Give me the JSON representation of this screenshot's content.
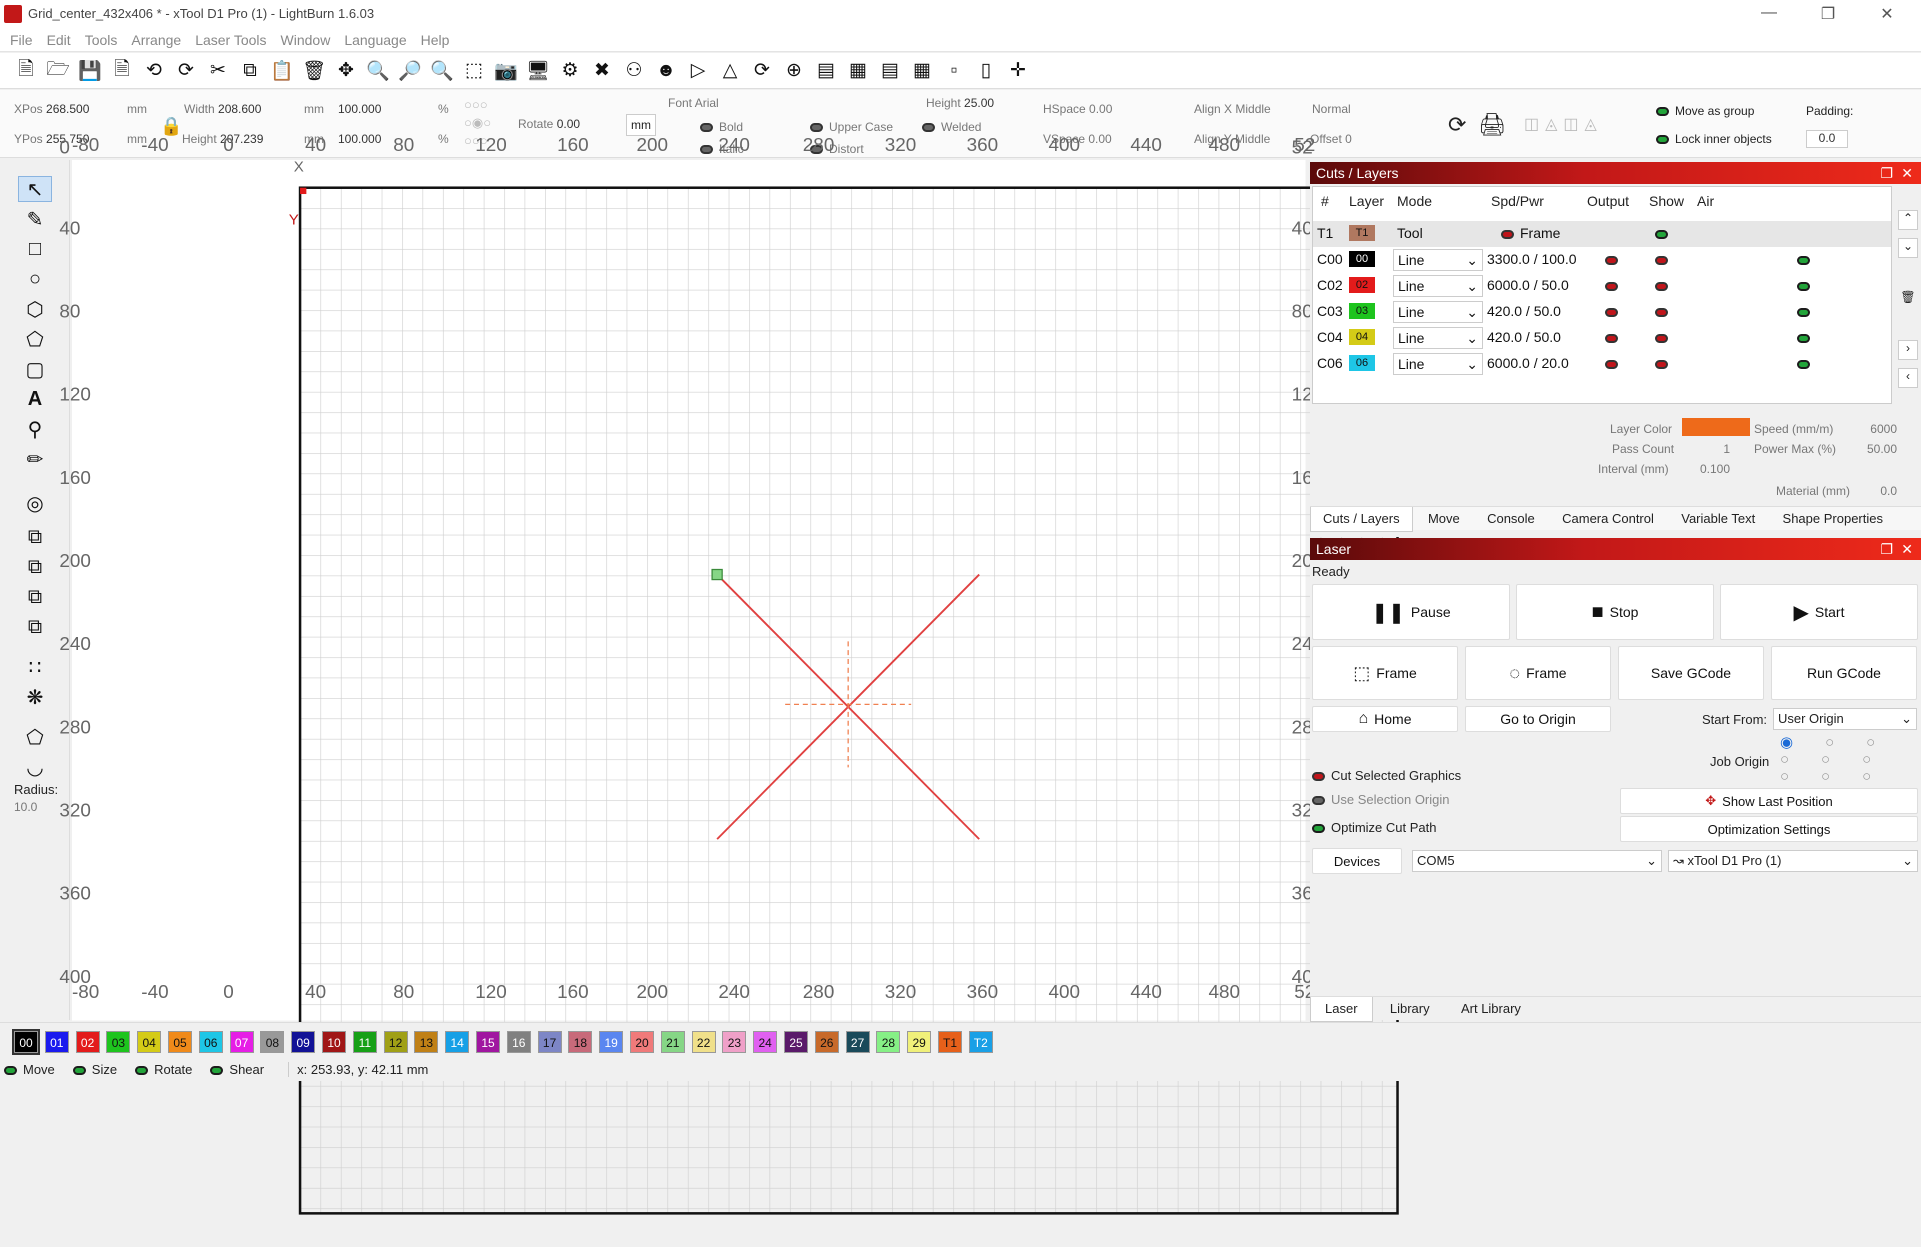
{
  "window": {
    "title": "Grid_center_432x406 * - xTool D1 Pro (1) - LightBurn 1.6.03"
  },
  "menu": [
    "File",
    "Edit",
    "Tools",
    "Arrange",
    "Laser Tools",
    "Window",
    "Language",
    "Help"
  ],
  "props": {
    "xpos_label": "XPos",
    "xpos": "268.500",
    "ypos_label": "YPos",
    "ypos": "255.750",
    "mm1": "mm",
    "mm2": "mm",
    "width_label": "Width",
    "width": "208.600",
    "height_label": "Height",
    "height": "207.239",
    "wmm": "mm",
    "hmm": "mm",
    "wpct": "100.000",
    "hpct": "100.000",
    "pct1": "%",
    "pct2": "%",
    "rotate_label": "Rotate",
    "rotate": "0.00",
    "unit_btn": "mm",
    "font_label": "Font",
    "font": "Arial",
    "fheight_label": "Height",
    "fheight": "25.00",
    "hspace_label": "HSpace",
    "hspace": "0.00",
    "vspace_label": "VSpace",
    "vspace": "0.00",
    "alignx_label": "Align X",
    "alignx": "Middle",
    "aligny_label": "Align Y",
    "aligny": "Middle",
    "normal": "Normal",
    "offset_label": "Offset",
    "offset": "0",
    "bold": "Bold",
    "italic": "Italic",
    "upper": "Upper Case",
    "distort": "Distort",
    "welded": "Welded",
    "move_group": "Move as group",
    "lock_inner": "Lock inner objects",
    "padding_label": "Padding:",
    "padding": "0.0"
  },
  "lefttools": {
    "radius_label": "Radius:",
    "radius": "10.0"
  },
  "ruler": {
    "top": [
      "-80",
      "-40",
      "0",
      "40",
      "80",
      "120",
      "160",
      "200",
      "240",
      "280",
      "320",
      "360",
      "400",
      "440",
      "480",
      "52"
    ],
    "bottom": [
      "-80",
      "-40",
      "0",
      "40",
      "80",
      "120",
      "160",
      "200",
      "240",
      "280",
      "320",
      "360",
      "400",
      "440",
      "480",
      "52"
    ],
    "left": [
      "0",
      "40",
      "80",
      "120",
      "160",
      "200",
      "240",
      "280",
      "320",
      "360",
      "400"
    ],
    "right": [
      "52",
      "40",
      "80",
      "120",
      "160",
      "200",
      "240",
      "280",
      "320",
      "360",
      "400"
    ],
    "x_marker": "X",
    "y_marker": "Y"
  },
  "cuts": {
    "title": "Cuts / Layers",
    "headers": [
      "#",
      "Layer",
      "Mode",
      "Spd/Pwr",
      "Output",
      "Show",
      "Air"
    ],
    "rows": [
      {
        "id": "T1",
        "layer": "T1",
        "color": "#b07860",
        "mode": "Tool",
        "spd": "Frame",
        "tool": true
      },
      {
        "id": "C00",
        "layer": "00",
        "color": "#000000",
        "mode": "Line",
        "spd": "3300.0 / 100.0"
      },
      {
        "id": "C02",
        "layer": "02",
        "color": "#e31b1b",
        "mode": "Line",
        "spd": "6000.0 / 50.0"
      },
      {
        "id": "C03",
        "layer": "03",
        "color": "#1ec41e",
        "mode": "Line",
        "spd": "420.0 / 50.0"
      },
      {
        "id": "C04",
        "layer": "04",
        "color": "#d4cb17",
        "mode": "Line",
        "spd": "420.0 / 50.0"
      },
      {
        "id": "C06",
        "layer": "06",
        "color": "#1ec6e6",
        "mode": "Line",
        "spd": "6000.0 / 20.0"
      }
    ],
    "layer_color_label": "Layer Color",
    "layer_color": "#ee6a1a",
    "speed_label": "Speed (mm/m)",
    "speed": "6000",
    "pass_label": "Pass Count",
    "pass": "1",
    "powermax_label": "Power Max (%)",
    "powermax": "50.00",
    "interval_label": "Interval (mm)",
    "interval": "0.100",
    "material_label": "Material (mm)",
    "material": "0.0",
    "tabs": [
      "Cuts / Layers",
      "Move",
      "Console",
      "Camera Control",
      "Variable Text",
      "Shape Properties"
    ]
  },
  "laser": {
    "title": "Laser",
    "status": "Ready",
    "pause": "Pause",
    "stop": "Stop",
    "start": "Start",
    "frame1": "Frame",
    "frame2": "Frame",
    "save_gcode": "Save GCode",
    "run_gcode": "Run GCode",
    "home": "Home",
    "go_origin": "Go to Origin",
    "start_from_label": "Start From:",
    "start_from": "User Origin",
    "job_origin_label": "Job Origin",
    "cut_selected": "Cut Selected Graphics",
    "use_sel_origin": "Use Selection Origin",
    "optimize": "Optimize Cut Path",
    "show_last": "Show Last Position",
    "opt_settings": "Optimization Settings",
    "devices": "Devices",
    "port": "COM5",
    "device": "xTool D1 Pro (1)",
    "tabs": [
      "Laser",
      "Library",
      "Art Library"
    ]
  },
  "palette": [
    {
      "l": "00",
      "c": "#000000",
      "t": "#fff"
    },
    {
      "l": "01",
      "c": "#1a1aee",
      "t": "#fff"
    },
    {
      "l": "02",
      "c": "#e31b1b",
      "t": "#fff"
    },
    {
      "l": "03",
      "c": "#1ec41e",
      "t": "#111"
    },
    {
      "l": "04",
      "c": "#d4cb17",
      "t": "#111"
    },
    {
      "l": "05",
      "c": "#f08a1a",
      "t": "#111"
    },
    {
      "l": "06",
      "c": "#1ec6e6",
      "t": "#111"
    },
    {
      "l": "07",
      "c": "#e61ee6",
      "t": "#fff"
    },
    {
      "l": "08",
      "c": "#999999",
      "t": "#111"
    },
    {
      "l": "09",
      "c": "#121296",
      "t": "#fff"
    },
    {
      "l": "10",
      "c": "#a01616",
      "t": "#fff"
    },
    {
      "l": "11",
      "c": "#16a016",
      "t": "#fff"
    },
    {
      "l": "12",
      "c": "#a0a016",
      "t": "#111"
    },
    {
      "l": "13",
      "c": "#c08016",
      "t": "#111"
    },
    {
      "l": "14",
      "c": "#16a0e6",
      "t": "#fff"
    },
    {
      "l": "15",
      "c": "#a016a0",
      "t": "#fff"
    },
    {
      "l": "16",
      "c": "#808080",
      "t": "#fff"
    },
    {
      "l": "17",
      "c": "#7d86c6",
      "t": "#111"
    },
    {
      "l": "18",
      "c": "#c86a7a",
      "t": "#111"
    },
    {
      "l": "19",
      "c": "#5a86f0",
      "t": "#fff"
    },
    {
      "l": "20",
      "c": "#f07a7a",
      "t": "#111"
    },
    {
      "l": "21",
      "c": "#86d686",
      "t": "#111"
    },
    {
      "l": "22",
      "c": "#f0e08a",
      "t": "#111"
    },
    {
      "l": "23",
      "c": "#f0a0c8",
      "t": "#111"
    },
    {
      "l": "24",
      "c": "#e060f0",
      "t": "#111"
    },
    {
      "l": "25",
      "c": "#5a1a6a",
      "t": "#fff"
    },
    {
      "l": "26",
      "c": "#c86a2a",
      "t": "#111"
    },
    {
      "l": "27",
      "c": "#1a4a5a",
      "t": "#fff"
    },
    {
      "l": "28",
      "c": "#86f086",
      "t": "#111"
    },
    {
      "l": "29",
      "c": "#f0f07a",
      "t": "#111"
    },
    {
      "l": "T1",
      "c": "#e6601a",
      "t": "#111"
    },
    {
      "l": "T2",
      "c": "#1aa0e6",
      "t": "#fff"
    }
  ],
  "status": {
    "move": "Move",
    "size": "Size",
    "rotate": "Rotate",
    "shear": "Shear",
    "coords": "x: 253.93, y: 42.11 mm"
  }
}
